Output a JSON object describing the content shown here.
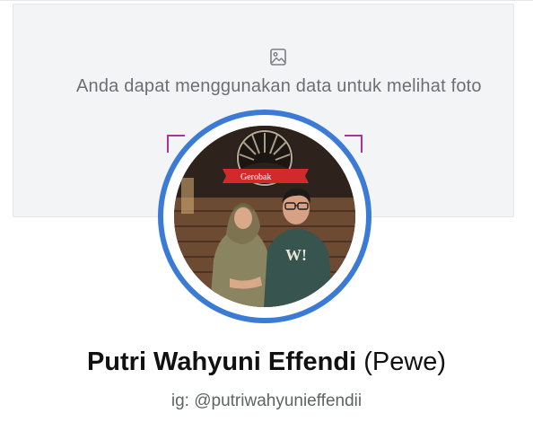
{
  "cover": {
    "message": "Anda dapat menggunakan data untuk melihat foto",
    "icon": "image-icon",
    "background_color": "#f3f4f6"
  },
  "profile": {
    "photo": {
      "ring_color": "#3b7bd6",
      "sign_text": "Gerobak"
    },
    "name": "Putri Wahyuni Effendi",
    "nickname": "(Pewe)",
    "bio": "ig: @putriwahyunieffendii"
  }
}
